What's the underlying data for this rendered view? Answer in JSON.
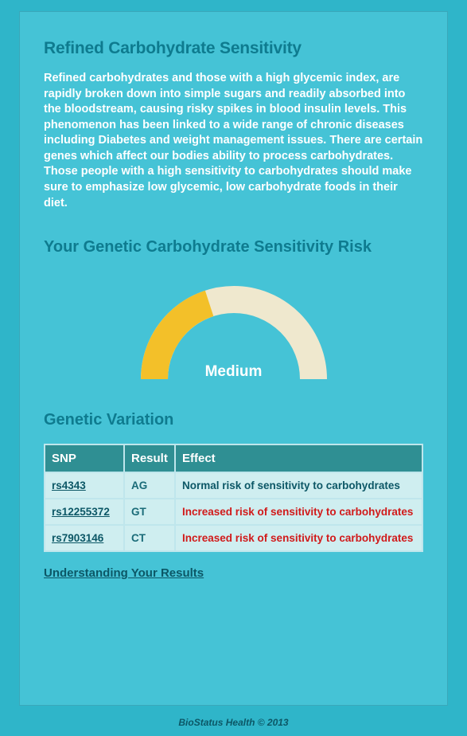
{
  "title": "Refined Carbohydrate Sensitivity",
  "intro": "Refined carbohydrates and those with a high glycemic index, are rapidly broken down into simple sugars and readily absorbed into the bloodstream, causing risky spikes in blood insulin levels. This phenomenon has been linked to a wide range of chronic diseases including Diabetes and weight management issues. There are certain genes which affect our bodies ability to process carbohydrates. Those people with a high sensitivity to carbohydrates should make sure to emphasize low glycemic, low carbohydrate foods in their diet.",
  "risk": {
    "heading": "Your Genetic Carbohydrate Sensitivity Risk",
    "level": "Medium"
  },
  "variation": {
    "heading": "Genetic Variation",
    "columns": {
      "snp": "SNP",
      "result": "Result",
      "effect": "Effect"
    },
    "rows": [
      {
        "snp": "rs4343",
        "result": "AG",
        "effect": "Normal risk of sensitivity to carbohydrates",
        "severity": "normal"
      },
      {
        "snp": "rs12255372",
        "result": "GT",
        "effect": "Increased risk of sensitivity to carbohydrates",
        "severity": "increased"
      },
      {
        "snp": "rs7903146",
        "result": "CT",
        "effect": "Increased risk of sensitivity to carbohydrates",
        "severity": "increased"
      }
    ]
  },
  "understand_link": "Understanding Your Results",
  "footer": "BioStatus Health © 2013",
  "chart_data": {
    "type": "gauge",
    "title": "Your Genetic Carbohydrate Sensitivity Risk",
    "value_label": "Medium",
    "value_fraction": 0.4,
    "range": [
      "Low",
      "Medium",
      "High"
    ],
    "colors": {
      "filled": "#f3c029",
      "track": "#efe8ce"
    }
  }
}
